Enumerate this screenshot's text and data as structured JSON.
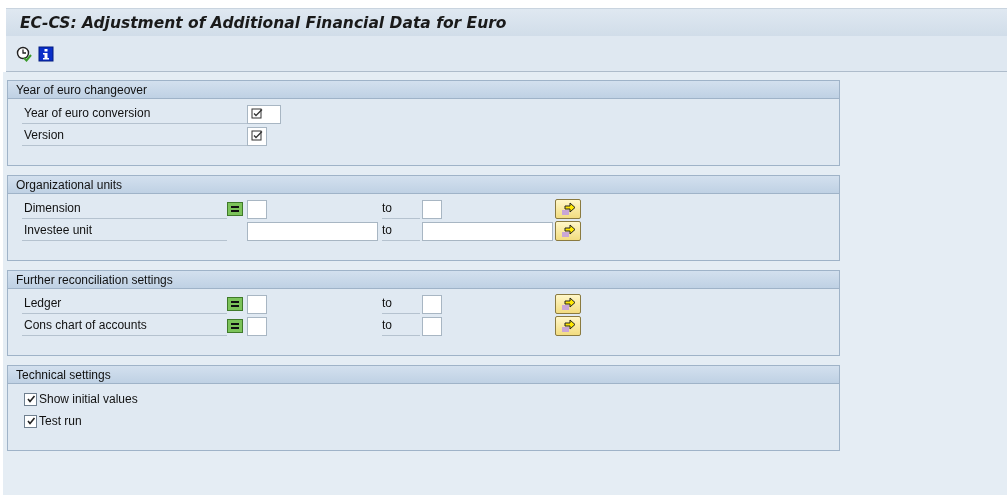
{
  "window": {
    "title": "EC-CS: Adjustment of Additional Financial Data for Euro"
  },
  "toolbar": {
    "buttons": [
      {
        "kind": "execute"
      },
      {
        "kind": "info"
      }
    ]
  },
  "groups": [
    {
      "title": "Year of euro changeover",
      "kind": "params",
      "rows": [
        {
          "label": "Year of euro conversion",
          "kind": "medium",
          "required": true
        },
        {
          "label": "Version",
          "kind": "short",
          "required": true
        }
      ]
    },
    {
      "title": "Organizational units",
      "kind": "ranges",
      "rows": [
        {
          "label": "Dimension",
          "kind": "short",
          "option_icon": true,
          "to": "to"
        },
        {
          "label": "Investee unit",
          "kind": "long",
          "option_icon": false,
          "to": "to"
        }
      ]
    },
    {
      "title": "Further reconciliation settings",
      "kind": "ranges",
      "rows": [
        {
          "label": "Ledger",
          "kind": "short",
          "option_icon": true,
          "to": "to"
        },
        {
          "label": "Cons chart of accounts",
          "kind": "short",
          "option_icon": true,
          "to": "to"
        }
      ]
    },
    {
      "title": "Technical settings",
      "kind": "checks",
      "rows": [
        {
          "label": "Show initial values",
          "checked": true
        },
        {
          "label": "Test run",
          "checked": true
        }
      ]
    }
  ]
}
